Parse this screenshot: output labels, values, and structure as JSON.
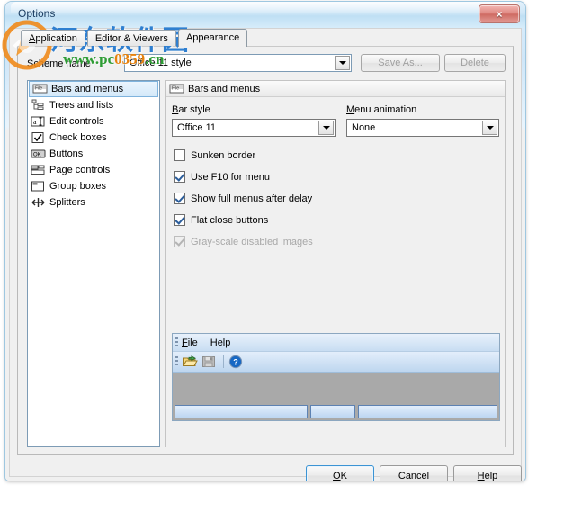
{
  "window": {
    "title": "Options",
    "close_label": "×"
  },
  "tabs": [
    {
      "label": "Application",
      "accel": "A",
      "selected": false
    },
    {
      "label": "Editor & Viewers",
      "accel": "E",
      "selected": false
    },
    {
      "label": "Appearance",
      "accel": "A",
      "selected": true
    }
  ],
  "scheme": {
    "label": "Scheme name",
    "value": "Office 11 style",
    "save_as_label": "Save As...",
    "save_as_enabled": false,
    "delete_label": "Delete",
    "delete_enabled": false
  },
  "category_list": {
    "selected_index": 0,
    "items": [
      {
        "label": "Bars and menus",
        "icon": "menubar-icon"
      },
      {
        "label": "Trees and lists",
        "icon": "tree-icon"
      },
      {
        "label": "Edit controls",
        "icon": "edit-control-icon"
      },
      {
        "label": "Check boxes",
        "icon": "checkbox-icon"
      },
      {
        "label": "Buttons",
        "icon": "ok-button-icon"
      },
      {
        "label": "Page controls",
        "icon": "page-control-icon"
      },
      {
        "label": "Group boxes",
        "icon": "group-box-icon"
      },
      {
        "label": "Splitters",
        "icon": "splitter-icon"
      }
    ]
  },
  "settings_group": {
    "header": "Bars and menus",
    "header_icon": "menubar-icon",
    "bar_style": {
      "label": "Bar style",
      "accel": "B",
      "value": "Office 11"
    },
    "menu_animation": {
      "label": "Menu animation",
      "accel": "M",
      "value": "None"
    },
    "checkboxes": [
      {
        "label": "Sunken border",
        "accel": "S",
        "checked": false,
        "enabled": true
      },
      {
        "label": "Use F10 for menu",
        "accel": "U",
        "checked": true,
        "enabled": true
      },
      {
        "label": "Show full menus after delay",
        "accel": "h",
        "checked": true,
        "enabled": true
      },
      {
        "label": "Flat close buttons",
        "accel": "F",
        "checked": true,
        "enabled": true
      },
      {
        "label": "Gray-scale disabled images",
        "accel": "G",
        "checked": true,
        "enabled": false
      }
    ]
  },
  "preview": {
    "menu_items": [
      "File",
      "Help"
    ],
    "toolbar_buttons": [
      {
        "name": "open-icon",
        "enabled": true
      },
      {
        "name": "save-icon",
        "enabled": false
      },
      {
        "name": "help-icon",
        "enabled": true
      }
    ],
    "status_panes": [
      "",
      "",
      ""
    ]
  },
  "footer": {
    "ok_label": "OK",
    "cancel_label": "Cancel",
    "help_label": "Help"
  },
  "watermark": {
    "chinese": "河东软件园",
    "url_part1": "www.pc",
    "url_part2": "0359",
    "url_part3": ".cn"
  },
  "colors": {
    "titlebar": "#cde6f7",
    "close_button": "#cf6a62",
    "selection": "#d4e9f9",
    "accent_border": "#7d9bb5",
    "preview_bg": "#a9a9a9"
  }
}
